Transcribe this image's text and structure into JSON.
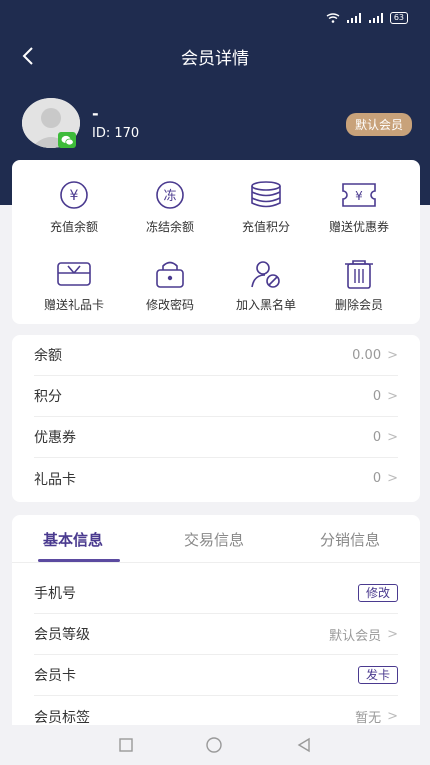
{
  "statusbar": {
    "battery": "63"
  },
  "navbar": {
    "title": "会员详情"
  },
  "profile": {
    "name": "-",
    "id_text": "ID: 170",
    "level": "默认会员"
  },
  "actions": [
    {
      "label": "充值余额",
      "icon": "yuan-coin-icon"
    },
    {
      "label": "冻结余额",
      "icon": "freeze-icon"
    },
    {
      "label": "充值积分",
      "icon": "coin-stack-icon"
    },
    {
      "label": "赠送优惠券",
      "icon": "coupon-icon"
    },
    {
      "label": "赠送礼品卡",
      "icon": "gift-card-icon"
    },
    {
      "label": "修改密码",
      "icon": "lock-icon"
    },
    {
      "label": "加入黑名单",
      "icon": "block-user-icon"
    },
    {
      "label": "删除会员",
      "icon": "trash-icon"
    }
  ],
  "assets": [
    {
      "label": "余额",
      "value": "0.00"
    },
    {
      "label": "积分",
      "value": "0"
    },
    {
      "label": "优惠券",
      "value": "0"
    },
    {
      "label": "礼品卡",
      "value": "0"
    }
  ],
  "tabs": [
    "基本信息",
    "交易信息",
    "分销信息"
  ],
  "basic_info": [
    {
      "label": "手机号",
      "action": "修改"
    },
    {
      "label": "会员等级",
      "value": "默认会员"
    },
    {
      "label": "会员卡",
      "action": "发卡"
    },
    {
      "label": "会员标签",
      "value": "暂无"
    }
  ],
  "colors": {
    "header": "#1f2c4f",
    "accent": "#4a3a8f",
    "badge": "#c8a27a"
  }
}
